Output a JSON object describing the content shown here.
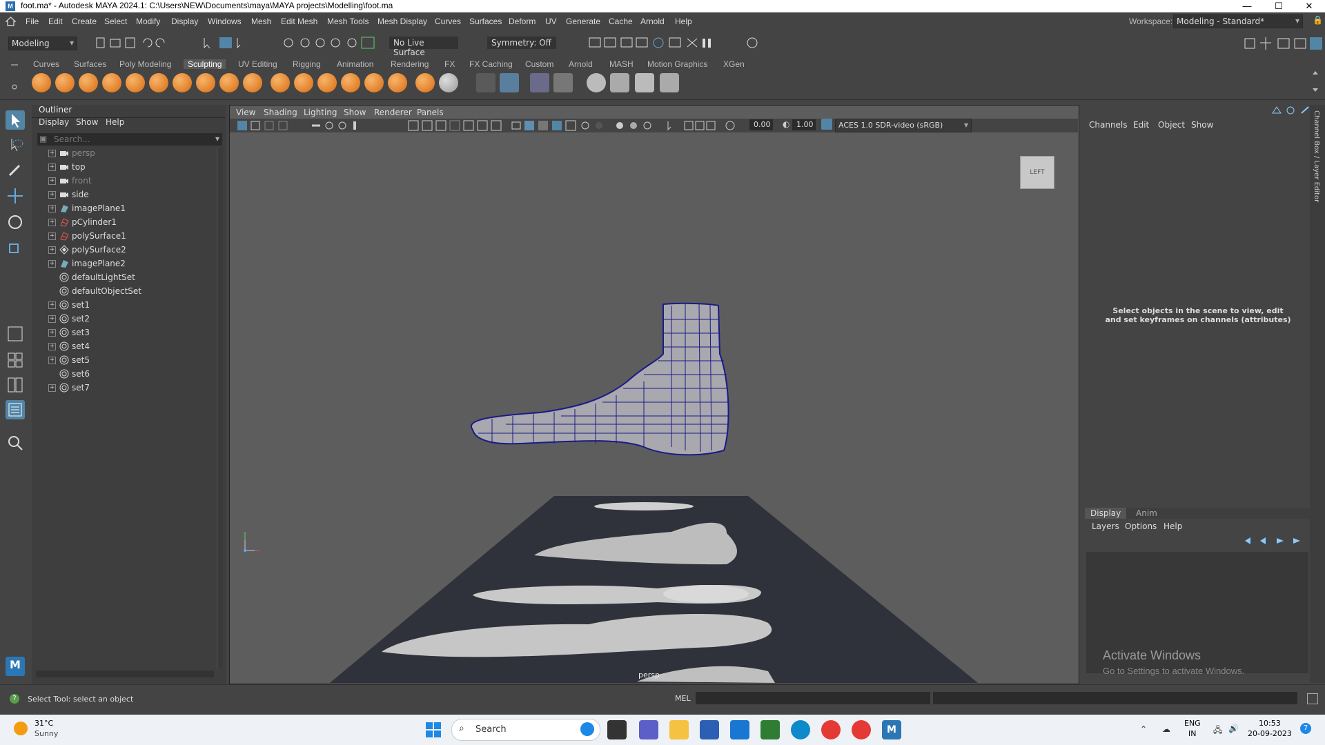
{
  "window": {
    "title": "foot.ma* - Autodesk MAYA 2024.1: C:\\Users\\NEW\\Documents\\maya\\MAYA  projects\\Modelling\\foot.ma",
    "app_badge": "M",
    "minimize": "—",
    "maximize": "☐",
    "close": "✕"
  },
  "menubar": {
    "items": [
      "File",
      "Edit",
      "Create",
      "Select",
      "Modify",
      "Display",
      "Windows",
      "Mesh",
      "Edit Mesh",
      "Mesh Tools",
      "Mesh Display",
      "Curves",
      "Surfaces",
      "Deform",
      "UV",
      "Generate",
      "Cache",
      "Arnold",
      "Help"
    ],
    "workspace_label": "Workspace:",
    "workspace_value": "Modeling - Standard*"
  },
  "statusline": {
    "mode": "Modeling",
    "live_surface": "No Live Surface",
    "symmetry": "Symmetry: Off"
  },
  "shelf": {
    "tabs": [
      "Curves",
      "Surfaces",
      "Poly Modeling",
      "Sculpting",
      "UV Editing",
      "Rigging",
      "Animation",
      "Rendering",
      "FX",
      "FX Caching",
      "Custom",
      "Arnold",
      "MASH",
      "Motion Graphics",
      "XGen"
    ],
    "active_tab": "Sculpting"
  },
  "outliner": {
    "title": "Outliner",
    "menu": [
      "Display",
      "Show",
      "Help"
    ],
    "search_placeholder": "Search...",
    "items": [
      {
        "label": "persp",
        "icon": "camera-icon",
        "expandable": true,
        "dim": true
      },
      {
        "label": "top",
        "icon": "camera-icon",
        "expandable": true,
        "dim": false
      },
      {
        "label": "front",
        "icon": "camera-icon",
        "expandable": true,
        "dim": true
      },
      {
        "label": "side",
        "icon": "camera-icon",
        "expandable": true,
        "dim": false
      },
      {
        "label": "imagePlane1",
        "icon": "image-plane-icon",
        "expandable": true,
        "dim": false
      },
      {
        "label": "pCylinder1",
        "icon": "mesh-icon",
        "expandable": true,
        "dim": false
      },
      {
        "label": "polySurface1",
        "icon": "mesh-icon",
        "expandable": true,
        "dim": false
      },
      {
        "label": "polySurface2",
        "icon": "group-icon",
        "expandable": true,
        "dim": false
      },
      {
        "label": "imagePlane2",
        "icon": "image-plane-icon",
        "expandable": true,
        "dim": false
      },
      {
        "label": "defaultLightSet",
        "icon": "set-icon",
        "expandable": false,
        "dim": false
      },
      {
        "label": "defaultObjectSet",
        "icon": "set-icon",
        "expandable": false,
        "dim": false
      },
      {
        "label": "set1",
        "icon": "set-icon",
        "expandable": true,
        "dim": false
      },
      {
        "label": "set2",
        "icon": "set-icon",
        "expandable": true,
        "dim": false
      },
      {
        "label": "set3",
        "icon": "set-icon",
        "expandable": true,
        "dim": false
      },
      {
        "label": "set4",
        "icon": "set-icon",
        "expandable": true,
        "dim": false
      },
      {
        "label": "set5",
        "icon": "set-icon",
        "expandable": true,
        "dim": false
      },
      {
        "label": "set6",
        "icon": "set-icon",
        "expandable": false,
        "dim": false
      },
      {
        "label": "set7",
        "icon": "set-icon",
        "expandable": true,
        "dim": false
      }
    ]
  },
  "viewport": {
    "menu": [
      "View",
      "Shading",
      "Lighting",
      "Show",
      "Renderer",
      "Panels"
    ],
    "exposure": "0.00",
    "gamma": "1.00",
    "colorspace": "ACES 1.0 SDR-video (sRGB)",
    "viewcube_label": "LEFT",
    "camera_label": "persp"
  },
  "channelbox": {
    "menu": [
      "Channels",
      "Edit",
      "Object",
      "Show"
    ],
    "side_tab": "Channel Box / Layer Editor",
    "empty_message": "Select objects in the scene to view, edit and set keyframes on channels (attributes)",
    "layer_tabs": [
      "Display",
      "Anim"
    ],
    "layer_menu": [
      "Layers",
      "Options",
      "Help"
    ],
    "watermark_title": "Activate Windows",
    "watermark_sub": "Go to Settings to activate Windows."
  },
  "helpline": {
    "text": "Select Tool: select an object",
    "cmd_lang": "MEL"
  },
  "taskbar": {
    "weather_temp": "31°C",
    "weather_desc": "Sunny",
    "search_placeholder": "Search",
    "lang1": "ENG",
    "lang2": "IN",
    "time": "10:53",
    "date": "20-09-2023",
    "notif_count": "7"
  }
}
